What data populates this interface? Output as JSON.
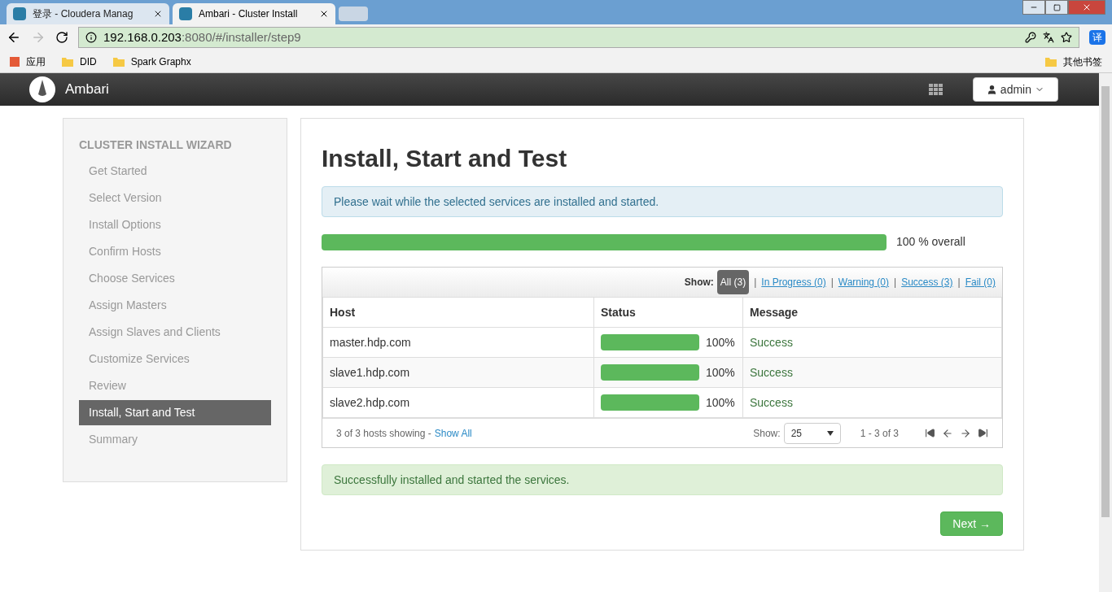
{
  "browser": {
    "tabs": [
      {
        "label": "登录 - Cloudera Manag",
        "selected": false
      },
      {
        "label": "Ambari - Cluster Install",
        "selected": true
      }
    ],
    "address": {
      "host": "192.168.0.203",
      "rest": ":8080/#/installer/step9"
    },
    "bookmarks": [
      "应用",
      "DID",
      "Spark Graphx"
    ],
    "other_bookmarks": "其他书签",
    "translate": "译"
  },
  "navbar": {
    "brand": "Ambari",
    "user": "admin"
  },
  "sidebar": {
    "title": "CLUSTER INSTALL WIZARD",
    "items": [
      {
        "label": "Get Started",
        "selected": false
      },
      {
        "label": "Select Version",
        "selected": false
      },
      {
        "label": "Install Options",
        "selected": false
      },
      {
        "label": "Confirm Hosts",
        "selected": false
      },
      {
        "label": "Choose Services",
        "selected": false
      },
      {
        "label": "Assign Masters",
        "selected": false
      },
      {
        "label": "Assign Slaves and Clients",
        "selected": false
      },
      {
        "label": "Customize Services",
        "selected": false
      },
      {
        "label": "Review",
        "selected": false
      },
      {
        "label": "Install, Start and Test",
        "selected": true
      },
      {
        "label": "Summary",
        "selected": false
      }
    ]
  },
  "main": {
    "title": "Install, Start and Test",
    "info": "Please wait while the selected services are installed and started.",
    "overall": {
      "level": 1,
      "reading": "100 % overall"
    },
    "filter": {
      "label": "Show:",
      "separator": "|",
      "options": [
        {
          "label": "All (3)",
          "selected": true
        },
        {
          "label": "In Progress (0)",
          "selected": false
        },
        {
          "label": "Warning (0)",
          "selected": false
        },
        {
          "label": "Success (3)",
          "selected": false
        },
        {
          "label": "Fail (0)",
          "selected": false
        }
      ]
    },
    "table": {
      "columns": [
        "Host",
        "Status",
        "Message"
      ],
      "rows": [
        {
          "host": "master.hdp.com",
          "level": 1,
          "percent": "100%",
          "message": "Success"
        },
        {
          "host": "slave1.hdp.com",
          "level": 1,
          "percent": "100%",
          "message": "Success"
        },
        {
          "host": "slave2.hdp.com",
          "level": 1,
          "percent": "100%",
          "message": "Success"
        }
      ]
    },
    "footer": {
      "summary": "3 of 3 hosts showing - ",
      "show_all": "Show All",
      "show_label": "Show:",
      "page_size": "25",
      "range": "1 - 3 of 3"
    },
    "success": "Successfully installed and started the services.",
    "next": "Next →"
  }
}
